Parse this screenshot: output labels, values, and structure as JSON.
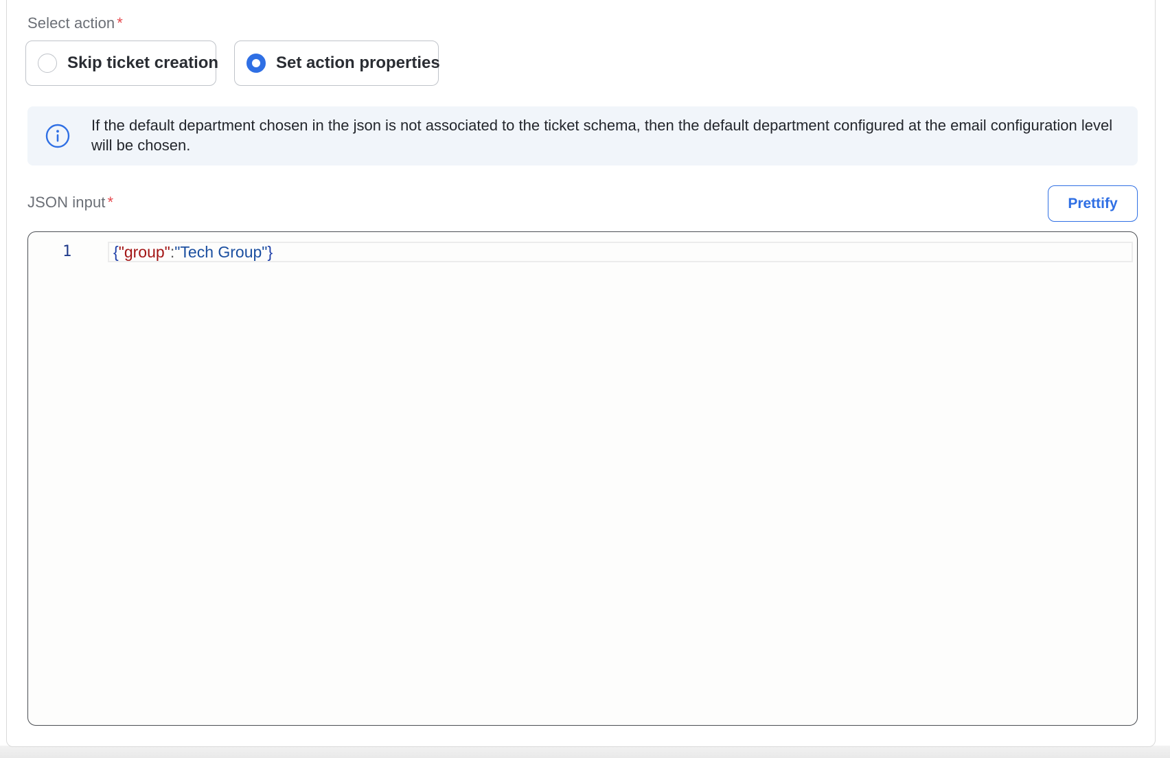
{
  "select_action": {
    "label": "Select action",
    "required_marker": "*",
    "options": [
      {
        "label": "Skip ticket creation",
        "selected": false
      },
      {
        "label": "Set action properties",
        "selected": true
      }
    ]
  },
  "info_banner": {
    "icon": "info-icon",
    "text": "If the default department chosen in the json is not associated to the ticket schema, then the default department configured at the email configuration level will be chosen."
  },
  "json_input": {
    "label": "JSON input",
    "required_marker": "*",
    "prettify_label": "Prettify",
    "lines": [
      {
        "number": "1",
        "tokens": {
          "open": "{",
          "key": "\"group\"",
          "colon": ":",
          "value": "\"Tech Group\"",
          "close": "}"
        }
      }
    ]
  },
  "colors": {
    "accent": "#2f6fe4",
    "required": "#e5484d",
    "info_background": "#f1f5fa",
    "json_key": "#a31515",
    "json_string": "#1b4fa0"
  }
}
